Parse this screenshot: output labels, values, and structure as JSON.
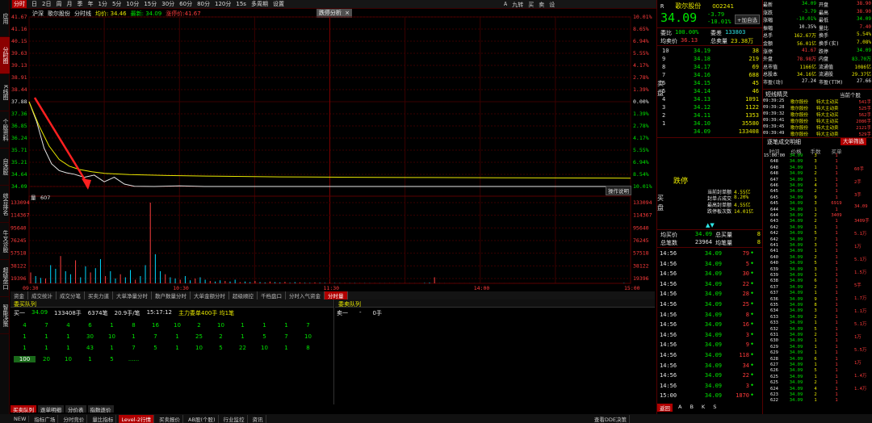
{
  "sidebar": [
    {
      "label": "应用",
      "active": false
    },
    {
      "label": "分时图",
      "active": true
    },
    {
      "label": "K线图",
      "active": false
    },
    {
      "label": "个股资料",
      "active": false
    },
    {
      "label": "自选股",
      "active": false
    },
    {
      "label": "综合排名",
      "active": false
    },
    {
      "label": "牛叉诊股",
      "active": false
    },
    {
      "label": "超级盘口",
      "active": false
    },
    {
      "label": "智能决策",
      "active": false
    }
  ],
  "topbar": {
    "items": [
      "分时",
      "日",
      "2日",
      "周",
      "月",
      "季",
      "年",
      "1分",
      "5分",
      "10分",
      "15分",
      "30分",
      "60分",
      "80分",
      "120分",
      "15s",
      "多周期",
      "设置"
    ],
    "active": "分时"
  },
  "chart_header": {
    "items": [
      {
        "t": "沪深",
        "c": "white"
      },
      {
        "t": "歌尔股份",
        "c": "white"
      },
      {
        "t": "分时线",
        "c": "white"
      },
      {
        "t": "均价: 34.46",
        "c": "yellow"
      },
      {
        "t": "最新: 34.09",
        "c": "green"
      },
      {
        "t": "涨停价:41.67",
        "c": "red"
      }
    ],
    "panel_title": "跌停分析",
    "panel_close": "×"
  },
  "price_axis": {
    "left": [
      "41.67",
      "41.16",
      "40.15",
      "39.63",
      "39.13",
      "38.91",
      "38.44",
      "37.88",
      "37.36",
      "36.85",
      "36.24",
      "35.71",
      "35.21",
      "34.64",
      "34.09"
    ],
    "right": [
      "10.01%",
      "8.65%",
      "6.94%",
      "5.55%",
      "4.17%",
      "2.78%",
      "1.39%",
      "0.00%",
      "1.39%",
      "2.78%",
      "4.17%",
      "5.55%",
      "6.94%",
      "8.54%",
      "10.01%"
    ]
  },
  "volume_axis": {
    "label": "量",
    "current": "607",
    "left": [
      "133094",
      "114367",
      "95640",
      "76245",
      "57518",
      "38122",
      "19396"
    ],
    "right": [
      "133094",
      "114367",
      "95640",
      "76245",
      "57518",
      "38122",
      "19396"
    ],
    "btn": "操作说明"
  },
  "time_axis": [
    "09:30",
    "10:30",
    "11:30",
    "14:00",
    "15:00"
  ],
  "tabs": [
    "资金",
    "成交统计",
    "成交分笔",
    "买卖力道",
    "大单净量分时",
    "散户数量分时",
    "大单金额分时",
    "超级顺控",
    "千档盘口",
    "分时入气资金",
    "分时量"
  ],
  "tabs_active": "分时量",
  "queue": {
    "left_title": "委买队列",
    "right_title": "委卖队列",
    "left_info": [
      {
        "t": "买一",
        "c": "white"
      },
      {
        "t": "34.09",
        "c": "green"
      },
      {
        "t": "133408手",
        "c": "white"
      },
      {
        "t": "6374笔",
        "c": "white"
      },
      {
        "t": "20.9手/笔",
        "c": "white"
      },
      {
        "t": "15:17:12",
        "c": "white"
      },
      {
        "t": "主力委单400手 均1笔",
        "c": "yellow"
      }
    ],
    "right_info": [
      {
        "t": "卖一",
        "c": "white"
      },
      {
        "t": "-",
        "c": "white"
      },
      {
        "t": "0手",
        "c": "white"
      }
    ],
    "rows": [
      [
        "4",
        "7",
        "4",
        "6",
        "1",
        "8",
        "16",
        "10",
        "2",
        "10",
        "1",
        "1",
        "1",
        "7"
      ],
      [
        "1",
        "1",
        "1",
        "30",
        "10",
        "1",
        "7",
        "1",
        "25",
        "2",
        "1",
        "5",
        "7",
        "10"
      ],
      [
        "1",
        "1",
        "1",
        "43",
        "1",
        "7",
        "5",
        "1",
        "10",
        "5",
        "22",
        "10",
        "1",
        "8"
      ],
      [
        "100",
        "20",
        "10",
        "1",
        "5",
        "......"
      ]
    ]
  },
  "bottombar": {
    "items": [
      "买卖队列",
      "逐单明细",
      "分价表",
      "指数逐价"
    ],
    "active": "买卖队列"
  },
  "statusbar": {
    "items": [
      "NEW",
      "指标广场",
      "分时竞价",
      "量比指标",
      "Level-2行情",
      "买卖报价",
      "AB股(个股)",
      "行业监控",
      "资讯"
    ],
    "active": "Level-2行情",
    "right": "查看DDE决策"
  },
  "stock": {
    "code": "002241",
    "name": "歌尔股份",
    "flag": "R",
    "price": "34.09",
    "change": "-3.79",
    "pct": "-10.01%",
    "btn": "+加自选"
  },
  "quote_top": [
    {
      "k": "委比",
      "v": "100.00%",
      "c": "green"
    },
    {
      "k": "委差",
      "v": "133803",
      "c": "cyan"
    }
  ],
  "quote_mid": [
    {
      "k": "均卖价",
      "v": "36.13",
      "c": "red"
    },
    {
      "k": "总卖量",
      "v": "23.38万",
      "c": "yellow"
    }
  ],
  "sell_levels": [
    {
      "n": "10",
      "p": "34.19",
      "v": "38"
    },
    {
      "n": "9",
      "p": "34.18",
      "v": "219"
    },
    {
      "n": "8",
      "p": "34.17",
      "v": "69"
    },
    {
      "n": "7",
      "p": "34.16",
      "v": "688"
    },
    {
      "n": "6",
      "p": "34.15",
      "v": "45"
    },
    {
      "n": "5",
      "p": "34.14",
      "v": "46"
    },
    {
      "n": "4",
      "p": "34.13",
      "v": "1091"
    },
    {
      "n": "3",
      "p": "34.12",
      "v": "1122"
    },
    {
      "n": "2",
      "p": "34.11",
      "v": "1353"
    },
    {
      "n": "1",
      "p": "34.10",
      "v": "35580"
    },
    {
      "n": "",
      "p": "34.09",
      "v": "133408"
    }
  ],
  "side_label_sell": "卖盘",
  "buy_area": {
    "label": "买盘",
    "limit": "跌停"
  },
  "quote_bottom": [
    {
      "k": "均买价",
      "v": "34.09",
      "c": "green",
      "k2": "总买量",
      "v2": "8"
    },
    {
      "k": "总笔数",
      "v": "23964",
      "c": "white",
      "k2": "均笔量",
      "v2": "8"
    }
  ],
  "stats": [
    {
      "k": "最新",
      "v": "34.09",
      "c": "green",
      "k2": "开盘",
      "v2": "38.90",
      "c2": "red"
    },
    {
      "k": "涨跌",
      "v": "-3.79",
      "c": "green",
      "k2": "最高",
      "v2": "38.90",
      "c2": "red"
    },
    {
      "k": "涨幅",
      "v": "-10.01%",
      "c": "green",
      "k2": "最低",
      "v2": "34.09",
      "c2": "green"
    },
    {
      "k": "振幅",
      "v": "10.35%",
      "c": "white",
      "k2": "量比",
      "v2": "7.40",
      "c2": "red"
    },
    {
      "k": "总手",
      "v": "162.67万",
      "c": "yellow",
      "k2": "换手",
      "v2": "5.54%",
      "c2": "yellow"
    },
    {
      "k": "金额",
      "v": "56.01亿",
      "c": "yellow",
      "k2": "换手(实)",
      "v2": "7.08%",
      "c2": "yellow"
    },
    {
      "k": "涨停",
      "v": "41.67",
      "c": "red",
      "k2": "跌停",
      "v2": "34.09",
      "c2": "green"
    },
    {
      "k": "外盘",
      "v": "78.98万",
      "c": "red",
      "k2": "内盘",
      "v2": "83.70万",
      "c2": "green"
    },
    {
      "k": "总市值",
      "v": "1166亿",
      "c": "yellow",
      "k2": "流通值",
      "v2": "1086亿",
      "c2": "yellow"
    },
    {
      "k": "总股本",
      "v": "34.16亿",
      "c": "yellow",
      "k2": "流通股",
      "v2": "29.37亿",
      "c2": "yellow"
    },
    {
      "k": "市盈(动)",
      "v": "27.24",
      "c": "white",
      "k2": "市盈(TTM)",
      "v2": "27.66",
      "c2": "white"
    }
  ],
  "limit_analysis": [
    {
      "k": "当前封单额",
      "v": "4.55亿"
    },
    {
      "k": "封单占成交",
      "v": "8.20%"
    },
    {
      "k": "最高封单额",
      "v": "4.55亿"
    },
    {
      "k": "跌停板次数",
      "v": "14.01亿"
    }
  ],
  "dynamics": {
    "title": "短线精灵",
    "btn": "当前个股",
    "rows": [
      {
        "t": "09:39:25",
        "n": "歌尔股份",
        "e": "特大主动买",
        "v": "541手"
      },
      {
        "t": "09:39:28",
        "n": "歌尔股份",
        "e": "特大主动卖",
        "v": "525手"
      },
      {
        "t": "09:39:32",
        "n": "歌尔股份",
        "e": "特大主动买",
        "v": "562手"
      },
      {
        "t": "09:39:41",
        "n": "歌尔股份",
        "e": "特大主动买",
        "v": "2086手"
      },
      {
        "t": "09:39:45",
        "n": "歌尔股份",
        "e": "特大主动卖",
        "v": "2121手"
      },
      {
        "t": "09:39:49",
        "n": "歌尔股份",
        "e": "特大主动卖",
        "v": "529手"
      }
    ]
  },
  "trades_rt": [
    {
      "t": "14:56",
      "p": "34.09",
      "v": "79"
    },
    {
      "t": "14:56",
      "p": "34.09",
      "v": "5"
    },
    {
      "t": "14:56",
      "p": "34.09",
      "v": "30"
    },
    {
      "t": "14:56",
      "p": "34.09",
      "v": "22"
    },
    {
      "t": "14:56",
      "p": "34.09",
      "v": "28"
    },
    {
      "t": "14:56",
      "p": "34.09",
      "v": "25"
    },
    {
      "t": "14:56",
      "p": "34.09",
      "v": "8"
    },
    {
      "t": "14:56",
      "p": "34.09",
      "v": "16"
    },
    {
      "t": "14:56",
      "p": "34.09",
      "v": "3"
    },
    {
      "t": "14:56",
      "p": "34.09",
      "v": "9"
    },
    {
      "t": "14:56",
      "p": "34.09",
      "v": "118"
    },
    {
      "t": "14:56",
      "p": "34.09",
      "v": "34"
    },
    {
      "t": "14:56",
      "p": "34.09",
      "v": "22"
    },
    {
      "t": "14:56",
      "p": "34.09",
      "v": "3"
    },
    {
      "t": "15:00",
      "p": "34.09",
      "v": "1870"
    }
  ],
  "trade_stats": {
    "label": "672"
  },
  "order_detail": {
    "title": "逐笔成交明细",
    "btn": "大单筛选",
    "headers": [
      "时间",
      "价格",
      "手数",
      "买单"
    ],
    "rows": [
      {
        "t": "15:00:00",
        "p": "34.09",
        "v": "3",
        "s": "1"
      },
      {
        "t": "648",
        "p": "34.09",
        "v": "3",
        "s": "1"
      },
      {
        "t": "648",
        "p": "34.09",
        "v": "1",
        "s": "1"
      },
      {
        "t": "648",
        "p": "34.09",
        "v": "2",
        "s": "1"
      },
      {
        "t": "647",
        "p": "34.09",
        "v": "1",
        "s": "1"
      },
      {
        "t": "646",
        "p": "34.09",
        "v": "4",
        "s": "1"
      },
      {
        "t": "645",
        "p": "34.09",
        "v": "2",
        "s": "1"
      },
      {
        "t": "645",
        "p": "34.09",
        "v": "9",
        "s": "1"
      },
      {
        "t": "645",
        "p": "34.09",
        "v": "3",
        "s": "6919"
      },
      {
        "t": "644",
        "p": "34.09",
        "v": "1",
        "s": "1"
      },
      {
        "t": "644",
        "p": "34.09",
        "v": "2",
        "s": "3409"
      },
      {
        "t": "643",
        "p": "34.09",
        "v": "2",
        "s": "1"
      },
      {
        "t": "642",
        "p": "34.09",
        "v": "1",
        "s": "1"
      },
      {
        "t": "642",
        "p": "34.09",
        "v": "5",
        "s": "1"
      },
      {
        "t": "642",
        "p": "34.09",
        "v": "7",
        "s": "1"
      },
      {
        "t": "641",
        "p": "34.09",
        "v": "3",
        "s": "1"
      },
      {
        "t": "641",
        "p": "34.09",
        "v": "1",
        "s": "1"
      },
      {
        "t": "640",
        "p": "34.09",
        "v": "2",
        "s": "1"
      },
      {
        "t": "640",
        "p": "34.09",
        "v": "5",
        "s": "1"
      },
      {
        "t": "639",
        "p": "34.09",
        "v": "3",
        "s": "1"
      },
      {
        "t": "639",
        "p": "34.09",
        "v": "1",
        "s": "1"
      },
      {
        "t": "638",
        "p": "34.09",
        "v": "6",
        "s": "1"
      },
      {
        "t": "637",
        "p": "34.09",
        "v": "2",
        "s": "1"
      },
      {
        "t": "637",
        "p": "34.09",
        "v": "1",
        "s": "1"
      },
      {
        "t": "636",
        "p": "34.09",
        "v": "9",
        "s": "1"
      },
      {
        "t": "635",
        "p": "34.09",
        "v": "8",
        "s": "1"
      },
      {
        "t": "634",
        "p": "34.09",
        "v": "3",
        "s": "1"
      },
      {
        "t": "633",
        "p": "34.09",
        "v": "2",
        "s": "1"
      },
      {
        "t": "633",
        "p": "34.09",
        "v": "1",
        "s": "1"
      },
      {
        "t": "632",
        "p": "34.09",
        "v": "5",
        "s": "1"
      },
      {
        "t": "631",
        "p": "34.09",
        "v": "2",
        "s": "1"
      },
      {
        "t": "630",
        "p": "34.09",
        "v": "1",
        "s": "1"
      },
      {
        "t": "629",
        "p": "34.09",
        "v": "1",
        "s": "1"
      },
      {
        "t": "629",
        "p": "34.09",
        "v": "1",
        "s": "1"
      },
      {
        "t": "628",
        "p": "34.09",
        "v": "6",
        "s": "1"
      },
      {
        "t": "627",
        "p": "34.09",
        "v": "1",
        "s": "1"
      },
      {
        "t": "626",
        "p": "34.09",
        "v": "5",
        "s": "1"
      },
      {
        "t": "625",
        "p": "34.09",
        "v": "1",
        "s": "1"
      },
      {
        "t": "625",
        "p": "34.09",
        "v": "2",
        "s": "1"
      },
      {
        "t": "624",
        "p": "34.09",
        "v": "4",
        "s": "1"
      },
      {
        "t": "623",
        "p": "34.09",
        "v": "2",
        "s": "1"
      },
      {
        "t": "622",
        "p": "34.09",
        "v": "1",
        "s": "1"
      }
    ],
    "side_labels": [
      "60手",
      "2手",
      "3手",
      "34.09",
      "3409手",
      "5.1万",
      "1万",
      "5.1万",
      "1.5万",
      "5手",
      "1.7万",
      "1.1万",
      "5.1万",
      "1万",
      "5.5万",
      "1万",
      "1.4万",
      "1.4万"
    ]
  },
  "right_bottom": {
    "left": "返回",
    "icons": [
      "A",
      "B",
      "K",
      "S"
    ],
    "right": "1.1万"
  },
  "window_icons": [
    "A",
    "九转",
    "买",
    "卖",
    "设"
  ],
  "chart_data": {
    "type": "line",
    "x_range": [
      "09:30",
      "15:00"
    ],
    "price_lines": [
      {
        "name": "分时线",
        "color": "#e6e6e6",
        "points": [
          [
            0,
            37.88
          ],
          [
            3,
            37.0
          ],
          [
            6,
            35.8
          ],
          [
            9,
            35.1
          ],
          [
            12,
            34.8
          ],
          [
            15,
            34.7
          ],
          [
            18,
            34.64
          ],
          [
            22,
            34.5
          ],
          [
            26,
            34.6
          ],
          [
            30,
            34.3
          ],
          [
            34,
            34.5
          ],
          [
            38,
            34.2
          ],
          [
            42,
            34.1
          ],
          [
            50,
            34.09
          ],
          [
            60,
            34.12
          ],
          [
            70,
            34.09
          ],
          [
            90,
            34.09
          ],
          [
            120,
            34.09
          ],
          [
            150,
            34.09
          ],
          [
            180,
            34.09
          ],
          [
            210,
            34.09
          ],
          [
            240,
            34.09
          ]
        ]
      },
      {
        "name": "均价",
        "color": "#e8e800",
        "points": [
          [
            0,
            37.88
          ],
          [
            4,
            36.8
          ],
          [
            8,
            35.9
          ],
          [
            12,
            35.3
          ],
          [
            16,
            35.0
          ],
          [
            20,
            34.85
          ],
          [
            25,
            34.75
          ],
          [
            30,
            34.68
          ],
          [
            40,
            34.62
          ],
          [
            55,
            34.58
          ],
          [
            75,
            34.55
          ],
          [
            100,
            34.52
          ],
          [
            130,
            34.5
          ],
          [
            160,
            34.49
          ],
          [
            190,
            34.48
          ],
          [
            220,
            34.47
          ],
          [
            240,
            34.46
          ]
        ]
      }
    ],
    "y_range": [
      34.09,
      41.67
    ],
    "prev_close": 37.88,
    "volume_range": [
      0,
      133094
    ],
    "volumes": [
      18000,
      12000,
      9000,
      8000,
      30000,
      24000,
      45000,
      20000,
      15000,
      38000,
      10000,
      28000,
      18000,
      25000,
      40000,
      12000,
      20000,
      8000,
      15000,
      10000,
      22000,
      6000,
      12000,
      30000,
      133094,
      48000,
      20000,
      15000,
      10000,
      8000,
      6000,
      12000,
      5000,
      8000,
      10000,
      6000,
      4000,
      3000,
      5000,
      4000,
      3000,
      6000,
      2000,
      3000,
      2000,
      4000,
      2000,
      1500,
      3000,
      2000,
      1500,
      2500,
      1000,
      2000,
      1500,
      1000,
      800,
      1500,
      1000,
      800,
      600,
      700,
      500,
      600,
      400,
      500,
      300,
      400,
      300,
      300,
      250,
      200,
      250,
      200,
      150,
      200,
      150,
      120,
      100,
      800,
      1200,
      10000,
      200,
      150,
      120,
      100,
      100,
      90,
      80,
      100,
      90,
      80,
      70,
      80,
      60,
      70,
      60,
      50,
      60,
      50,
      40,
      50,
      40,
      30,
      40,
      35,
      30,
      25,
      30,
      25,
      20,
      18,
      20,
      15,
      18,
      15,
      12,
      10,
      8,
      607
    ]
  }
}
